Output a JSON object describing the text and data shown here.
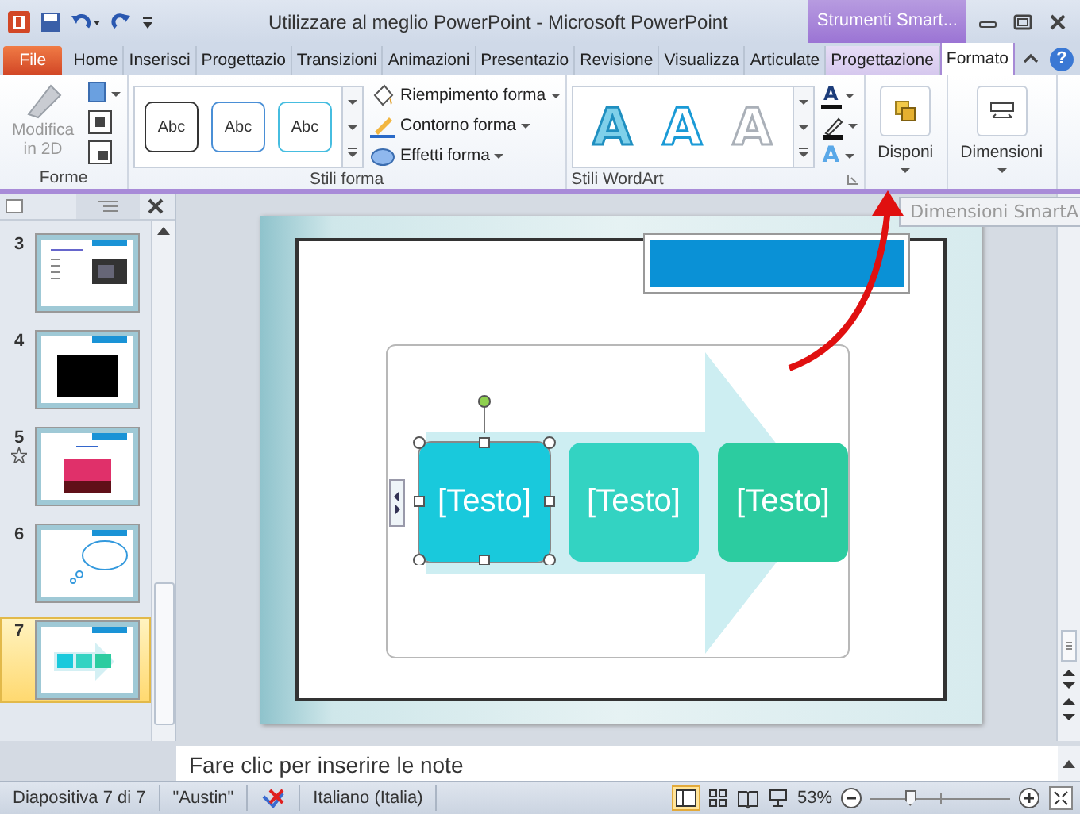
{
  "window": {
    "title": "Utilizzare al meglio PowerPoint  -  Microsoft PowerPoint",
    "contextual_tab": "Strumenti Smart..."
  },
  "tabs": [
    {
      "label": "File",
      "kind": "file",
      "selected": false
    },
    {
      "label": "Home",
      "kind": "normal",
      "selected": false
    },
    {
      "label": "Inserisci",
      "kind": "normal",
      "selected": false
    },
    {
      "label": "Progettazio",
      "kind": "normal",
      "selected": false
    },
    {
      "label": "Transizioni",
      "kind": "normal",
      "selected": false
    },
    {
      "label": "Animazioni",
      "kind": "normal",
      "selected": false
    },
    {
      "label": "Presentazio",
      "kind": "normal",
      "selected": false
    },
    {
      "label": "Revisione",
      "kind": "normal",
      "selected": false
    },
    {
      "label": "Visualizza",
      "kind": "normal",
      "selected": false
    },
    {
      "label": "Articulate",
      "kind": "normal",
      "selected": false
    },
    {
      "label": "Progettazione",
      "kind": "contextual",
      "selected": false
    },
    {
      "label": "Formato",
      "kind": "contextual",
      "selected": true
    }
  ],
  "ribbon": {
    "forme": {
      "label": "Forme",
      "edit_button": {
        "label": "Modifica in 2D",
        "disabled": true
      }
    },
    "stili_forma": {
      "label": "Stili forma",
      "styles": [
        "Abc",
        "Abc",
        "Abc"
      ],
      "commands": [
        "Riempimento forma",
        "Contorno forma",
        "Effetti forma"
      ]
    },
    "stili_wordart": {
      "label": "Stili WordArt",
      "styles": [
        "A",
        "A",
        "A"
      ],
      "text_fill_glyph": "A",
      "text_effects_glyph": "A"
    },
    "help_button": "?",
    "disponi": {
      "label": "Disponi"
    },
    "dimensioni": {
      "label": "Dimensioni"
    }
  },
  "tooltip": "Dimensioni SmartA",
  "slides": [
    {
      "number": "3",
      "selected": false,
      "animated": false,
      "kind": "photo"
    },
    {
      "number": "4",
      "selected": false,
      "animated": false,
      "kind": "black"
    },
    {
      "number": "5",
      "selected": false,
      "animated": true,
      "kind": "sunset"
    },
    {
      "number": "6",
      "selected": false,
      "animated": false,
      "kind": "cloud"
    },
    {
      "number": "7",
      "selected": true,
      "animated": false,
      "kind": "smartart"
    }
  ],
  "smartart": [
    {
      "text": "[Testo]",
      "selected": true,
      "color": "#19c9dc"
    },
    {
      "text": "[Testo]",
      "selected": false,
      "color": "#33d3c2"
    },
    {
      "text": "[Testo]",
      "selected": false,
      "color": "#2ccca0"
    }
  ],
  "notes": {
    "placeholder": "Fare clic per inserire le note"
  },
  "status_bar": {
    "slide": "Diapositiva 7 di 7",
    "theme": "\"Austin\"",
    "language": "Italiano (Italia)",
    "zoom": "53%",
    "zoom_slider": {
      "level": 0.28
    }
  }
}
